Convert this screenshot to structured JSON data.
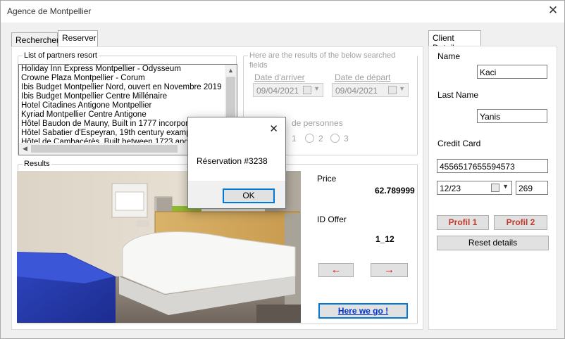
{
  "window": {
    "title": "Agence de Montpellier"
  },
  "tabs": [
    {
      "label": "Rechercher",
      "active": false
    },
    {
      "label": "Reserver",
      "active": true
    }
  ],
  "partners": {
    "group_label": "List of partners resort",
    "items": [
      "Holiday Inn Express Montpellier - Odysseum",
      "Crowne Plaza Montpellier - Corum",
      "Ibis Budget Montpellier Nord, ouvert en Novembre 2019",
      "Ibis Budget Montpellier Centre Millénaire",
      "Hotel Citadines Antigone Montpellier",
      "Kyriad Montpellier Centre Antigone",
      "Hôtel Baudon de Mauny, Built in 1777 incorporating",
      "Hôtel Sabatier d'Espeyran, 19th century example of",
      "Hôtel de Cambacérès, Built between 1723 and 173"
    ]
  },
  "search": {
    "group_label": "Here are the results of the below searched fields",
    "arrival_label": "Date d'arriver",
    "arrival_value": "09/04/2021",
    "departure_label": "Date de départ",
    "departure_value": "09/04/2021",
    "persons_label": "de personnes",
    "persons_options": [
      "1",
      "2",
      "3"
    ]
  },
  "results": {
    "group_label": "Results",
    "price_label": "Price",
    "price_value": "62.789999",
    "id_label": "ID Offer",
    "id_value": "1_12",
    "prev_label": "←",
    "next_label": "→",
    "go_label": "Here we go !"
  },
  "client": {
    "tab_label": "Client Details",
    "name_label": "Name",
    "name_value": "Kaci",
    "lastname_label": "Last Name",
    "lastname_value": "Yanis",
    "card_label": "Credit Card",
    "card_number": "4556517655594573",
    "card_expiry": "12/23",
    "card_cvv": "269",
    "profile1_label": "Profil 1",
    "profile2_label": "Profil 2",
    "reset_label": "Reset details"
  },
  "dialog": {
    "message": "Réservation #3238",
    "ok_label": "OK",
    "close_glyph": "✕"
  },
  "icons": {
    "close": "close-icon",
    "calendar": "calendar-icon",
    "dropdown": "chevron-down-icon"
  },
  "colors": {
    "accent": "#0078d7",
    "profile_text": "#c0392b",
    "arrow": "#d01010",
    "link": "#0033cc"
  }
}
